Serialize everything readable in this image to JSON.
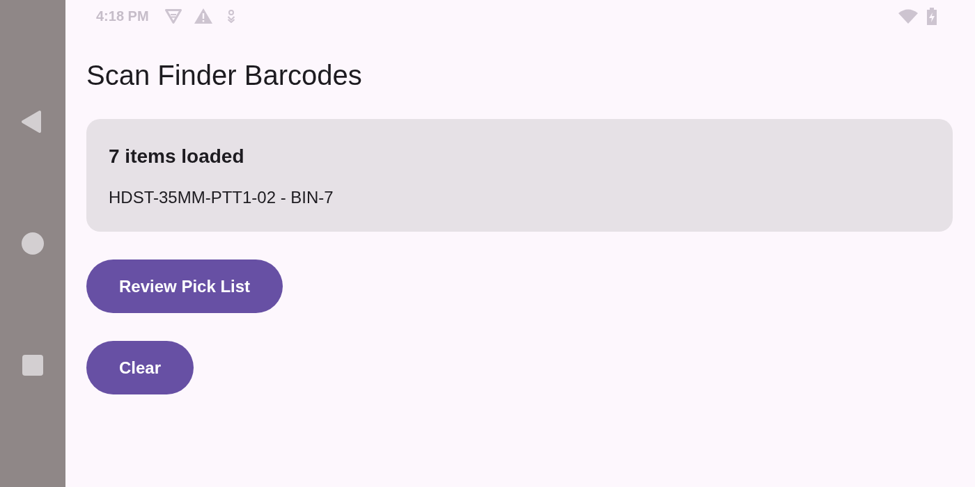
{
  "status_bar": {
    "time": "4:18 PM"
  },
  "screen": {
    "title": "Scan Finder Barcodes"
  },
  "summary_card": {
    "heading": "7 items loaded",
    "detail": "HDST-35MM-PTT1-02 - BIN-7"
  },
  "buttons": [
    {
      "label": "Review Pick List"
    },
    {
      "label": "Clear"
    }
  ]
}
